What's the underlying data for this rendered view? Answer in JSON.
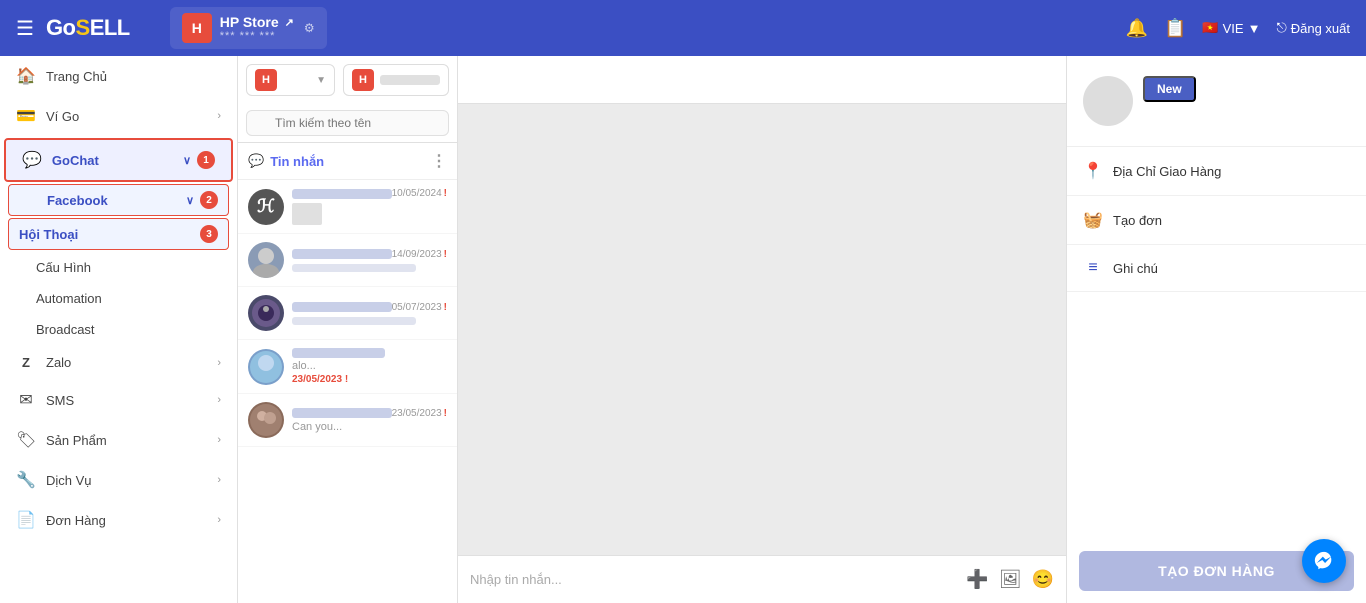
{
  "navbar": {
    "hamburger_icon": "☰",
    "logo": "GoSell",
    "store_icon_label": "H",
    "store_name": "HP Store",
    "store_link_icon": "↗",
    "store_stars": "*** *** ***",
    "store_settings_icon": "⚙",
    "notification_icon": "🔔",
    "clipboard_icon": "📋",
    "flag_emoji": "🇻🇳",
    "language": "VIE",
    "lang_dropdown_icon": "▼",
    "logout_icon": "→",
    "logout_label": "Đăng xuất"
  },
  "sidebar": {
    "items": [
      {
        "id": "trang-chu",
        "label": "Trang Chủ",
        "icon": "🏠",
        "has_arrow": false
      },
      {
        "id": "vi-go",
        "label": "Ví Go",
        "icon": "💳",
        "has_arrow": true
      },
      {
        "id": "gochat",
        "label": "GoChat",
        "icon": "💬",
        "has_arrow": true,
        "expanded": true
      },
      {
        "id": "facebook",
        "label": "Facebook",
        "has_arrow": true,
        "highlighted": true
      },
      {
        "id": "hoi-thoai",
        "label": "Hội Thoại",
        "has_arrow": false,
        "sub_highlighted": true
      },
      {
        "id": "cau-hinh",
        "label": "Cấu Hình",
        "has_arrow": false
      },
      {
        "id": "automation",
        "label": "Automation",
        "has_arrow": false
      },
      {
        "id": "broadcast",
        "label": "Broadcast",
        "has_arrow": false
      },
      {
        "id": "zalo",
        "label": "Zalo",
        "icon": "Z",
        "has_arrow": true
      },
      {
        "id": "sms",
        "label": "SMS",
        "icon": "✉",
        "has_arrow": true
      },
      {
        "id": "san-pham",
        "label": "Sản Phẩm",
        "icon": "🏷",
        "has_arrow": true
      },
      {
        "id": "dich-vu",
        "label": "Dịch Vụ",
        "icon": "🔧",
        "has_arrow": true
      },
      {
        "id": "don-hang",
        "label": "Đơn Hàng",
        "icon": "📄",
        "has_arrow": true
      }
    ]
  },
  "chat_panel": {
    "store_selector_label": "",
    "search_placeholder": "Tìm kiếm theo tên",
    "section_label": "Tin nhắn",
    "more_icon": "⋮",
    "chat_items": [
      {
        "id": "c1",
        "avatar_letter": "ℋ",
        "avatar_bg": "#555",
        "time": "10/05/2024",
        "alert": "!",
        "preview_text": ""
      },
      {
        "id": "c2",
        "avatar_letter": "",
        "avatar_bg": "#8a9bb5",
        "time": "14/09/2023",
        "alert": "!",
        "preview_text": ""
      },
      {
        "id": "c3",
        "avatar_letter": "",
        "avatar_bg": "#4a4a6a",
        "time": "05/07/2023",
        "alert": "!",
        "preview_text": ""
      },
      {
        "id": "c4",
        "avatar_letter": "",
        "avatar_bg": "#7a9fca",
        "time": "23/05/2023",
        "alert": "!",
        "preview_text": "alo..."
      },
      {
        "id": "c5",
        "avatar_letter": "",
        "avatar_bg": "#8a6a5a",
        "time": "23/05/2023",
        "alert": "!",
        "preview_text": "Can you..."
      }
    ]
  },
  "conversation": {
    "input_placeholder": "Nhập tin nhắn...",
    "attach_icon": "➕",
    "image_icon": "🖼",
    "emoji_icon": "😊"
  },
  "right_panel": {
    "new_badge_label": "New",
    "delivery_address_label": "Địa Chỉ Giao Hàng",
    "create_order_label": "Tạo đơn",
    "note_label": "Ghi chú",
    "tao_don_hang_label": "TẠO ĐƠN HÀNG",
    "location_icon": "📍",
    "basket_icon": "🧺",
    "note_icon": "≡"
  },
  "colors": {
    "accent": "#3b4fc3",
    "danger": "#e74c3c",
    "muted_bg": "#b0b8e0"
  }
}
